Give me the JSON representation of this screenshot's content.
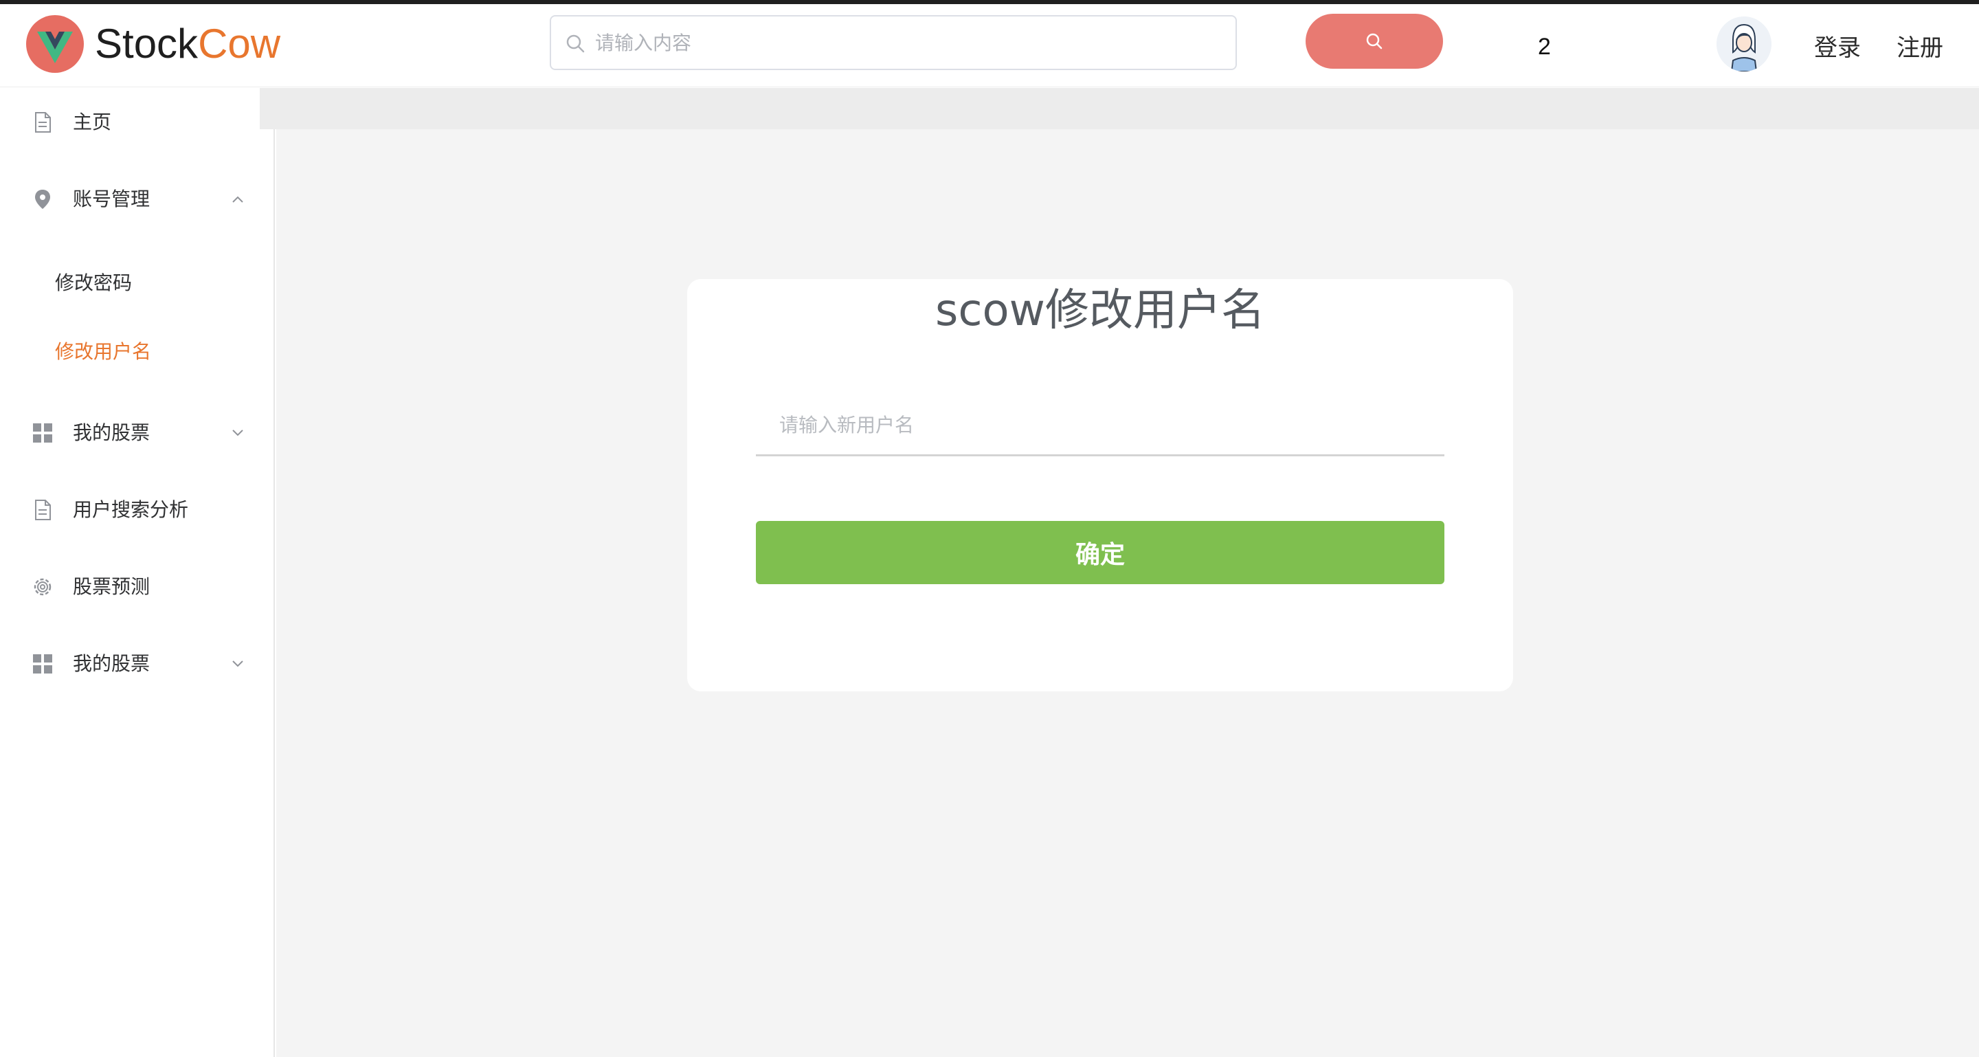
{
  "header": {
    "brand_part1": "Stock",
    "brand_part2": "Cow",
    "search_placeholder": "请输入内容",
    "counter": "2",
    "login_label": "登录",
    "register_label": "注册"
  },
  "sidebar": {
    "items": [
      {
        "label": "主页",
        "icon": "document-icon"
      },
      {
        "label": "账号管理",
        "icon": "location-icon",
        "expanded": true
      },
      {
        "label": "我的股票",
        "icon": "grid-icon",
        "expanded": false
      },
      {
        "label": "用户搜索分析",
        "icon": "document-icon"
      },
      {
        "label": "股票预测",
        "icon": "gear-icon"
      },
      {
        "label": "我的股票",
        "icon": "grid-icon",
        "expanded": false
      }
    ],
    "subitems": [
      {
        "label": "修改密码",
        "active": false
      },
      {
        "label": "修改用户名",
        "active": true
      }
    ]
  },
  "form": {
    "title": "scow修改用户名",
    "username_placeholder": "请输入新用户名",
    "confirm_label": "确定"
  },
  "colors": {
    "brand_accent": "#e8762e",
    "search_button": "#e87a72",
    "confirm_button": "#7fbf4f",
    "active_menu": "#e8762e",
    "logo_bg": "#e66d62"
  }
}
